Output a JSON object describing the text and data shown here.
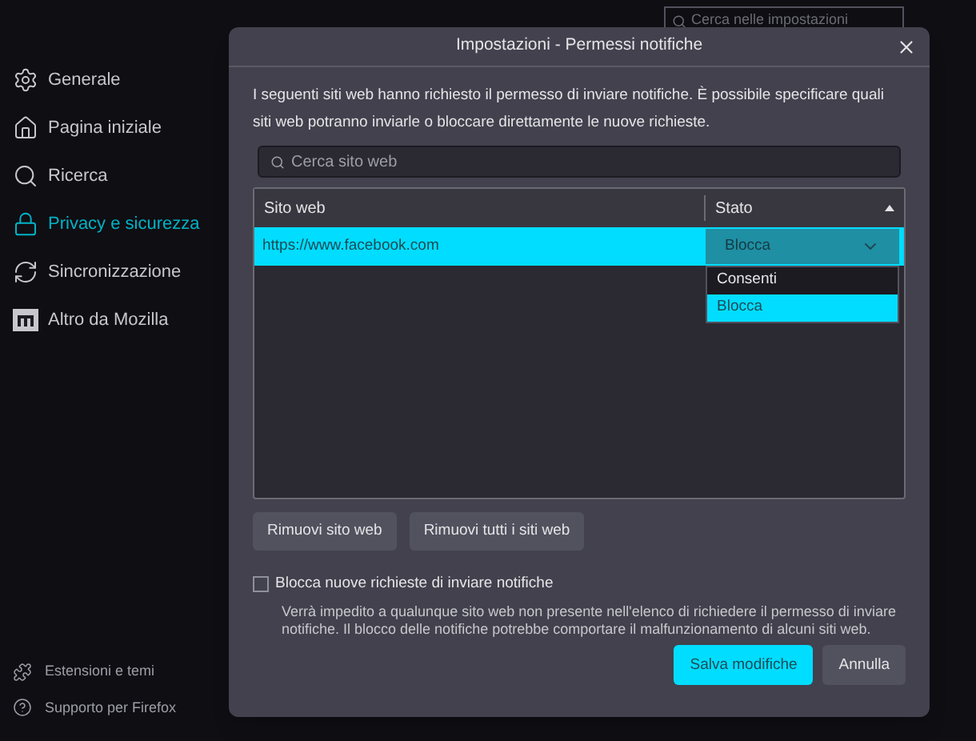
{
  "search": {
    "placeholder": "Cerca nelle impostazioni"
  },
  "sidebar": {
    "items": [
      {
        "label": "Generale",
        "kind": "gear",
        "selected": false
      },
      {
        "label": "Pagina iniziale",
        "kind": "home",
        "selected": false
      },
      {
        "label": "Ricerca",
        "kind": "search",
        "selected": false
      },
      {
        "label": "Privacy e sicurezza",
        "kind": "lock",
        "selected": true
      },
      {
        "label": "Sincronizzazione",
        "kind": "sync",
        "selected": false
      },
      {
        "label": "Altro da Mozilla",
        "kind": "mozilla",
        "selected": false
      }
    ],
    "footer_items": [
      {
        "label": "Estensioni e temi",
        "kind": "puzzle"
      },
      {
        "label": "Supporto per Firefox",
        "kind": "help"
      }
    ]
  },
  "dialog": {
    "title": "Impostazioni - Permessi notifiche",
    "description": "I seguenti siti web hanno richiesto il permesso di inviare notifiche. È possibile specificare quali siti web potranno inviarle o bloccare direttamente le nuove richieste.",
    "search": {
      "placeholder": "Cerca sito web"
    },
    "table": {
      "columns": [
        {
          "label": "Sito web",
          "sorted": false
        },
        {
          "label": "Stato",
          "sorted": true
        }
      ],
      "rows": [
        {
          "site": "https://www.facebook.com",
          "status": "Blocca",
          "selected": true,
          "dropdown_open": true,
          "options": [
            {
              "label": "Consenti",
              "selected": false
            },
            {
              "label": "Blocca",
              "selected": true
            }
          ]
        }
      ]
    },
    "buttons": [
      "Rimuovi sito web",
      "Rimuovi tutti i siti web"
    ],
    "block_checkbox": {
      "label": "Blocca nuove richieste di inviare notifiche",
      "checked": false,
      "note": "Verrà impedito a qualunque sito web non presente nell'elenco di richiedere il permesso di inviare notifiche. Il blocco delle notifiche potrebbe comportare il malfunzionamento di alcuni siti web."
    },
    "footer_buttons": [
      {
        "label": "Salva modifiche",
        "primary": true
      },
      {
        "label": "Annulla",
        "primary": false
      }
    ]
  }
}
